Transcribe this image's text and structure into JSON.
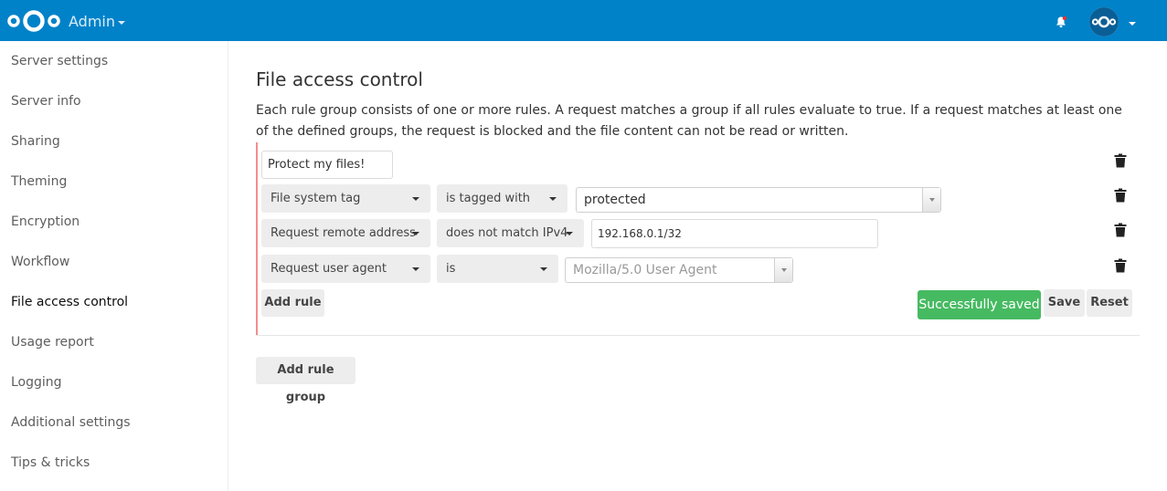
{
  "header": {
    "app_name": "Admin",
    "brand_color": "#0082c9"
  },
  "sidebar": {
    "items": [
      {
        "label": "Server settings"
      },
      {
        "label": "Server info"
      },
      {
        "label": "Sharing"
      },
      {
        "label": "Theming"
      },
      {
        "label": "Encryption"
      },
      {
        "label": "Workflow"
      },
      {
        "label": "File access control",
        "active": true
      },
      {
        "label": "Usage report"
      },
      {
        "label": "Logging"
      },
      {
        "label": "Additional settings"
      },
      {
        "label": "Tips & tricks"
      }
    ]
  },
  "main": {
    "title": "File access control",
    "description": "Each rule group consists of one or more rules. A request matches a group if all rules evaluate to true. If a request matches at least one of the defined groups, the request is blocked and the file content can not be read or written.",
    "group": {
      "name_value": "Protect my files!",
      "rules": [
        {
          "check": "File system tag",
          "operator": "is tagged with",
          "value": "protected"
        },
        {
          "check": "Request remote address",
          "operator": "does not match IPv4",
          "value": "192.168.0.1/32"
        },
        {
          "check": "Request user agent",
          "operator": "is",
          "value": "Mozilla/5.0 User Agent"
        }
      ],
      "add_rule_label": "Add rule",
      "status_label": "Successfully saved",
      "save_label": "Save",
      "reset_label": "Reset"
    },
    "add_group_label": "Add rule group"
  },
  "colors": {
    "accent": "#0082c9",
    "success": "#46ba61",
    "group_border": "#e9322d"
  }
}
